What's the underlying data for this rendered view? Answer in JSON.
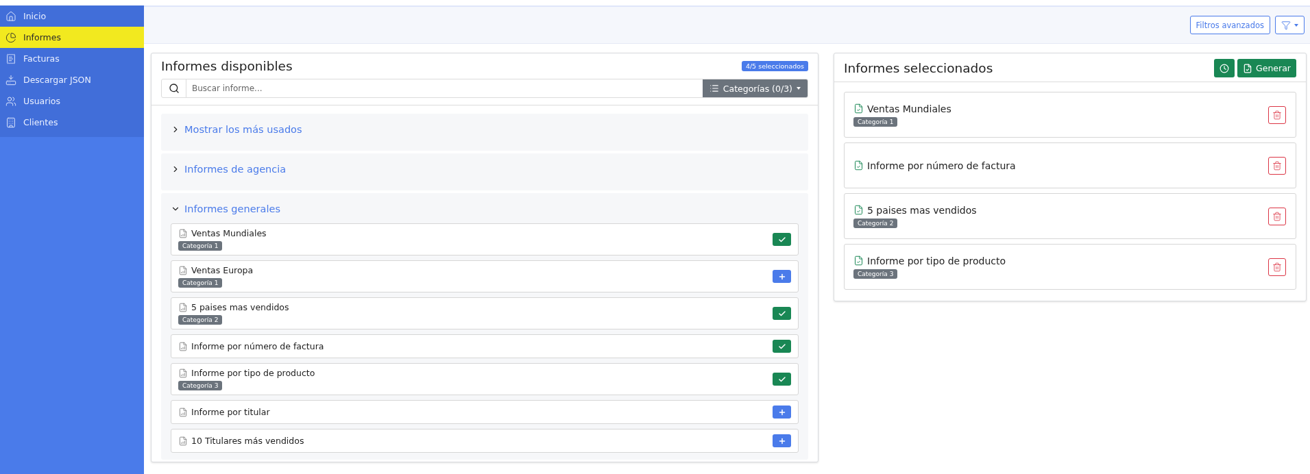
{
  "sidebar": {
    "items": [
      {
        "label": "Inicio",
        "selected": false
      },
      {
        "label": "Informes",
        "selected": true
      },
      {
        "label": "Facturas",
        "selected": false
      },
      {
        "label": "Descargar JSON",
        "selected": false
      },
      {
        "label": "Usuarios",
        "selected": false
      },
      {
        "label": "Clientes",
        "selected": false
      }
    ]
  },
  "toolbar": {
    "advanced_filters": "Filtros avanzados"
  },
  "available": {
    "title": "Informes disponibles",
    "badge": "4/5 seleccionados",
    "search": {
      "placeholder": "Buscar informe..."
    },
    "categories_button": "Categorías (0/3)",
    "groups": [
      {
        "title": "Mostrar los más usados",
        "expanded": false
      },
      {
        "title": "Informes de agencia",
        "expanded": false
      },
      {
        "title": "Informes generales",
        "expanded": true,
        "reports": [
          {
            "name": "Ventas Mundiales",
            "category": "Categoría 1",
            "selected": true
          },
          {
            "name": "Ventas Europa",
            "category": "Categoría 1",
            "selected": false
          },
          {
            "name": "5 paises mas vendidos",
            "category": "Categoría 2",
            "selected": true
          },
          {
            "name": "Informe por número de factura",
            "selected": true
          },
          {
            "name": "Informe por tipo de producto",
            "category": "Categoría 3",
            "selected": true
          },
          {
            "name": "Informe por titular",
            "selected": false
          },
          {
            "name": "10 Titulares más vendidos",
            "selected": false
          }
        ]
      }
    ]
  },
  "selected_panel": {
    "title": "Informes seleccionados",
    "generate_button": "Generar",
    "reports": [
      {
        "name": "Ventas Mundiales",
        "category": "Categoría 1"
      },
      {
        "name": "Informe por número de factura"
      },
      {
        "name": "5 paises mas vendidos",
        "category": "Categoría 2"
      },
      {
        "name": "Informe por tipo de producto",
        "category": "Categoría 3"
      }
    ]
  }
}
